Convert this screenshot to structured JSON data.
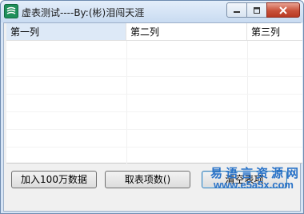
{
  "window": {
    "title": "虚表测试----By:(彬)泪闯天涯",
    "accent_color": "#c9513a",
    "app_icon": "app-logo-icon"
  },
  "caption_buttons": {
    "minimize_icon": "minimize-icon",
    "maximize_icon": "maximize-icon",
    "close_icon": "close-icon"
  },
  "listview": {
    "columns": [
      "第一列",
      "第二列",
      "第三列"
    ],
    "rows": []
  },
  "buttons": {
    "add_label": "加入100万数据",
    "count_label": "取表项数()",
    "clear_label": "清空表项"
  },
  "watermark": {
    "site_name": "易语言资源网",
    "site_url": "www.e5a5x.com"
  }
}
